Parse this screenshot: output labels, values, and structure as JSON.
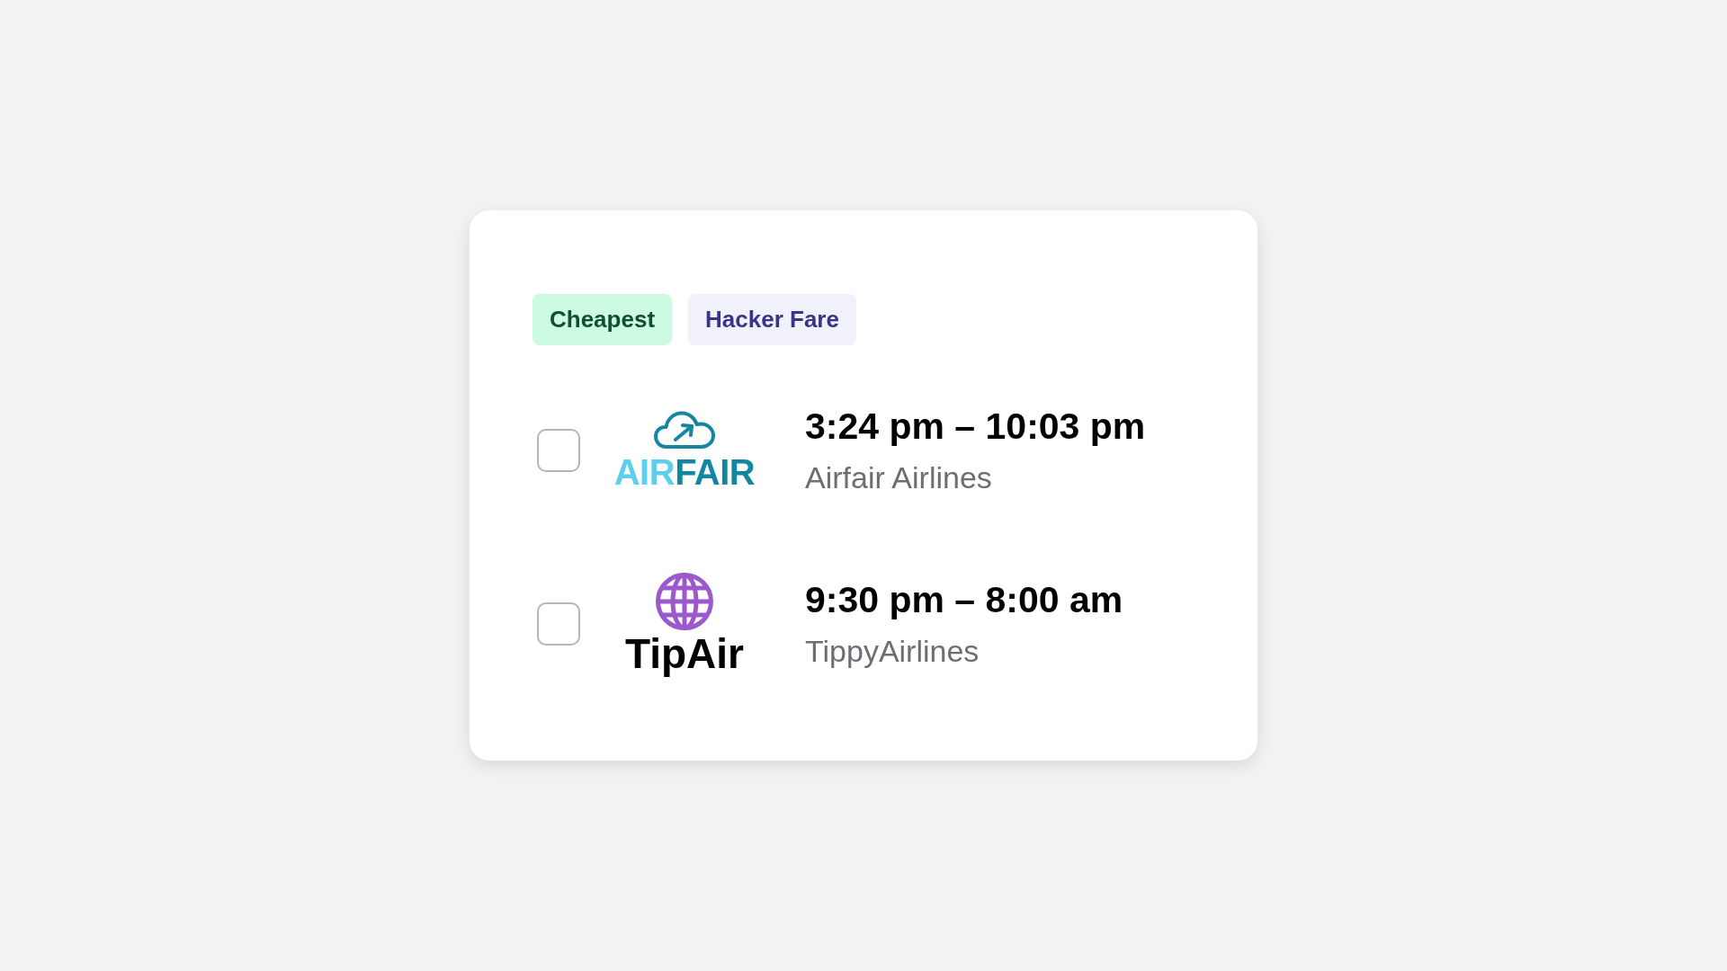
{
  "tags": [
    {
      "label": "Cheapest",
      "kind": "savings"
    },
    {
      "label": "Hacker Fare",
      "kind": "fare"
    }
  ],
  "flights": [
    {
      "checked": false,
      "logo": {
        "kind": "cloud",
        "wordmark": [
          {
            "text": "AIR",
            "color": "#5ccfee"
          },
          {
            "text": "FAIR",
            "color": "#15869f"
          }
        ]
      },
      "times": "3:24 pm – 10:03 pm",
      "airline": "Airfair Airlines"
    },
    {
      "checked": false,
      "logo": {
        "kind": "globe",
        "wordmark": [
          {
            "text": "TipAir",
            "color": "#000000"
          }
        ]
      },
      "times": "9:30 pm – 8:00 am",
      "airline": "TippyAirlines"
    }
  ]
}
